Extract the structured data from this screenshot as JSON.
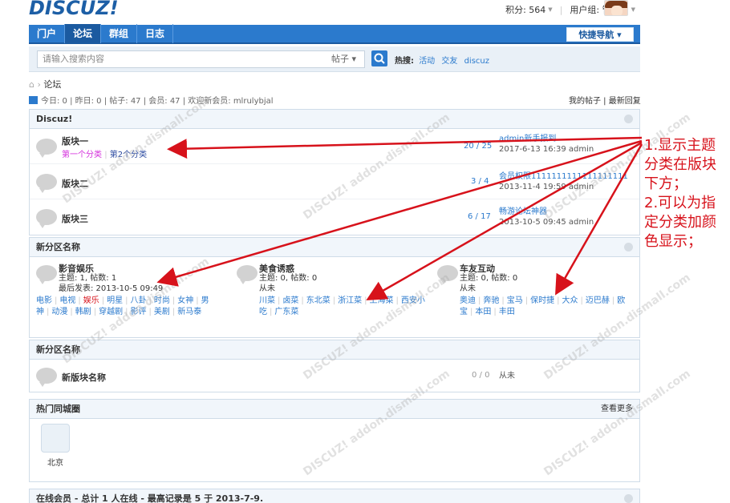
{
  "header": {
    "logo": "DISCUZ!",
    "points": "积分: 564",
    "user_group": "用户组: 管理员"
  },
  "nav": {
    "items": [
      "门户",
      "论坛",
      "群组",
      "日志"
    ],
    "active_index": 1,
    "quick_nav": "快捷导航 ▾"
  },
  "search": {
    "placeholder": "请输入搜索内容",
    "type": "帖子 ▾",
    "hot_label": "热搜:",
    "hot_terms": [
      "活动",
      "交友",
      "discuz"
    ]
  },
  "breadcrumb": "论坛",
  "stats": {
    "text": "今日: 0 | 昨日: 0 | 帖子: 47 | 会员: 47 | 欢迎新会员: mlrulybjal",
    "right": "我的帖子 | 最新回复"
  },
  "group1": {
    "title": "Discuz!",
    "forums": [
      {
        "name": "版块一",
        "subcats": [
          "第一个分类",
          "第2个分类"
        ],
        "counts": "20 / 25",
        "last_title": "admin新手报到",
        "last_info": "2017-6-13 16:39 admin"
      },
      {
        "name": "版块二",
        "subcats": [],
        "counts": "3 / 4",
        "last_title": "会员权限1111111111111111111",
        "last_info": "2013-11-4 19:59 admin"
      },
      {
        "name": "版块三",
        "subcats": [],
        "counts": "6 / 17",
        "last_title": "畅游论坛神器",
        "last_info": "2013-10-5 09:45 admin"
      }
    ]
  },
  "group2": {
    "title": "新分区名称",
    "cells": [
      {
        "name": "影音娱乐",
        "meta1": "主题: 1, 帖数: 1",
        "meta2": "最后发表: 2013-10-5 09:49",
        "tags": [
          "电影",
          "电视",
          "娱乐",
          "明星",
          "八卦",
          "时尚",
          "女神",
          "男神",
          "动漫",
          "韩剧",
          "穿越剧",
          "影评",
          "美剧",
          "新马泰"
        ]
      },
      {
        "name": "美食诱惑",
        "meta1": "主题: 0, 帖数: 0",
        "meta2": "从未",
        "tags": [
          "川菜",
          "卤菜",
          "东北菜",
          "浙江菜",
          "上海菜",
          "西安小吃",
          "广东菜"
        ]
      },
      {
        "name": "车友互动",
        "meta1": "主题: 0, 帖数: 0",
        "meta2": "从未",
        "tags": [
          "奥迪",
          "奔驰",
          "宝马",
          "保时捷",
          "大众",
          "迈巴赫",
          "欧宝",
          "本田",
          "丰田"
        ]
      }
    ]
  },
  "group3": {
    "title": "新分区名称",
    "forum": {
      "name": "新版块名称",
      "counts": "0 / 0",
      "last": "从未"
    }
  },
  "hotgroup": {
    "title": "热门同城圈",
    "more": "查看更多",
    "item": "北京"
  },
  "online": {
    "text": "在线会员 - 总计 1 人在线 - 最高记录是 5 于 2013-7-9."
  },
  "annotation": {
    "line1": "1.显示主题分类在版块下方；",
    "line2": "2.可以为指定分类加颜色显示；"
  },
  "colors": {
    "nav": "#2b7acd",
    "link": "#2b7acd",
    "subcat_highlight": "#d42edc",
    "annotation": "#d7121b"
  }
}
